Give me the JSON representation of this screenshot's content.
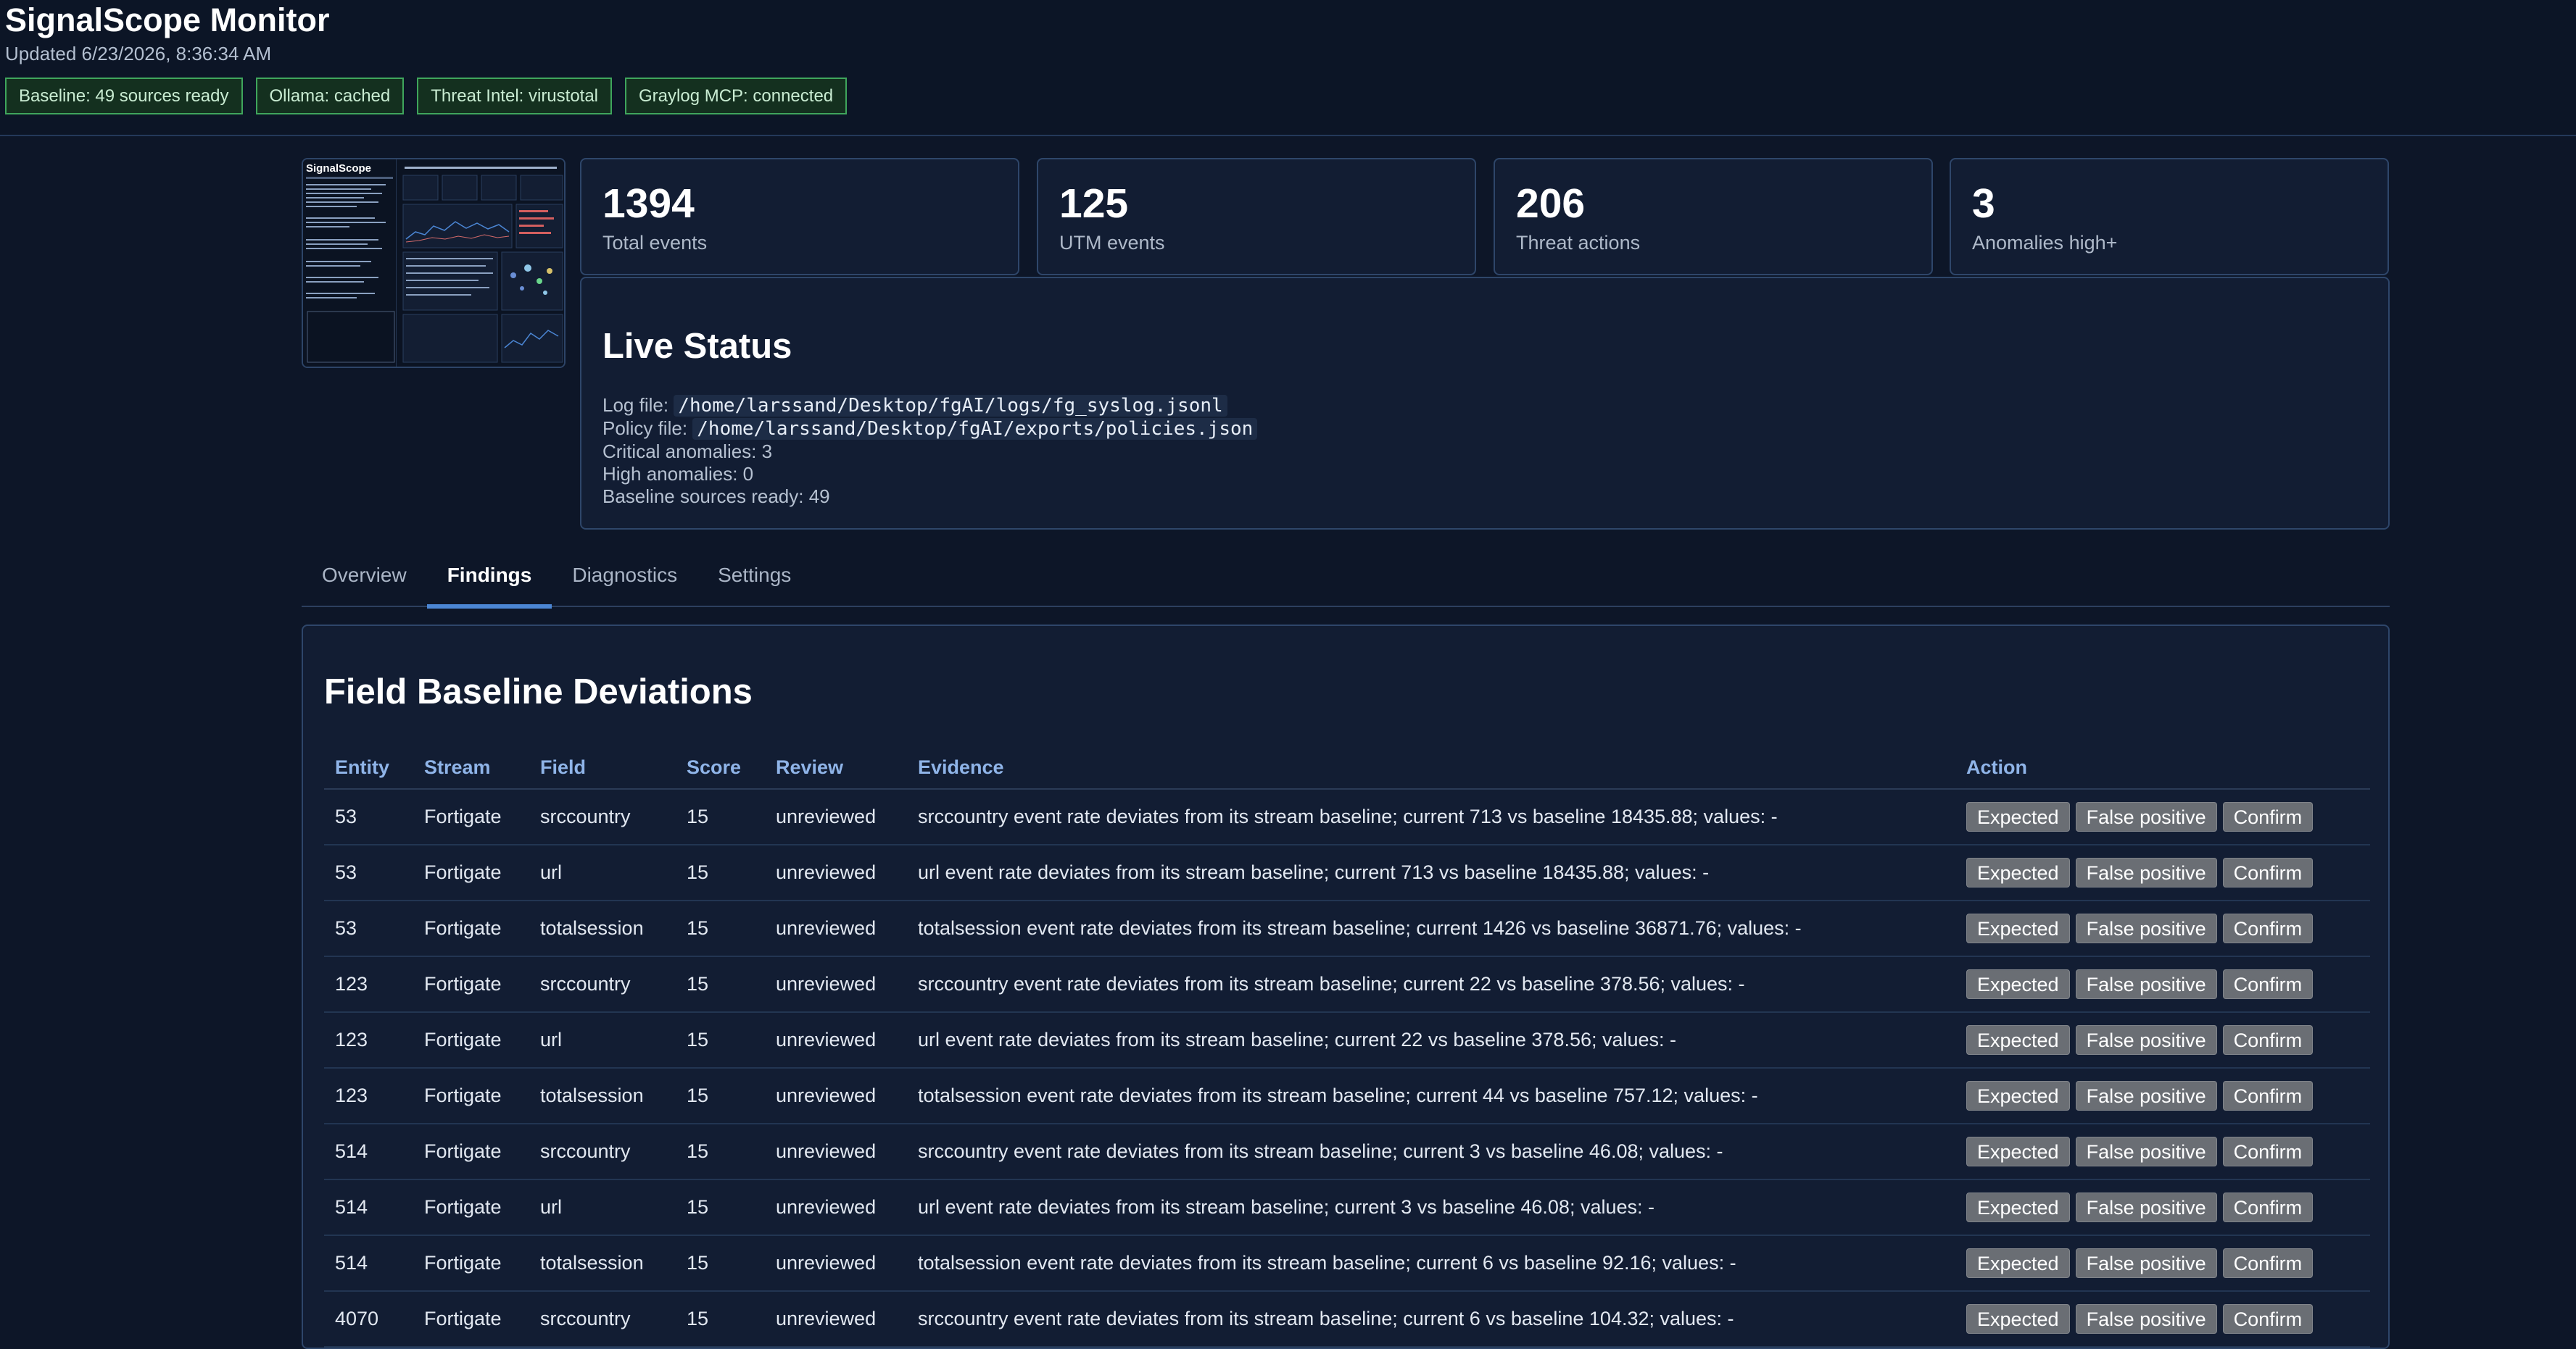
{
  "header": {
    "title": "SignalScope Monitor",
    "updated": "Updated 6/23/2026, 8:36:34 AM",
    "badges": [
      "Baseline: 49 sources ready",
      "Ollama: cached",
      "Threat Intel: virustotal",
      "Graylog MCP: connected"
    ]
  },
  "thumbnail": {
    "title": "SignalScope"
  },
  "stats": [
    {
      "value": "1394",
      "label": "Total events"
    },
    {
      "value": "125",
      "label": "UTM events"
    },
    {
      "value": "206",
      "label": "Threat actions"
    },
    {
      "value": "3",
      "label": "Anomalies high+"
    }
  ],
  "live_status": {
    "title": "Live Status",
    "log_label": "Log file:",
    "log_path": "/home/larssand/Desktop/fgAI/logs/fg_syslog.jsonl",
    "policy_label": "Policy file:",
    "policy_path": "/home/larssand/Desktop/fgAI/exports/policies.json",
    "critical": "Critical anomalies: 3",
    "high": "High anomalies: 0",
    "baseline": "Baseline sources ready: 49"
  },
  "tabs": [
    "Overview",
    "Findings",
    "Diagnostics",
    "Settings"
  ],
  "findings": {
    "title": "Field Baseline Deviations",
    "columns": [
      "Entity",
      "Stream",
      "Field",
      "Score",
      "Review",
      "Evidence",
      "Action"
    ],
    "actions": [
      "Expected",
      "False positive",
      "Confirm"
    ],
    "rows": [
      [
        "53",
        "Fortigate",
        "srccountry",
        "15",
        "unreviewed",
        "srccountry event rate deviates from its stream baseline; current 713 vs baseline 18435.88; values: -"
      ],
      [
        "53",
        "Fortigate",
        "url",
        "15",
        "unreviewed",
        "url event rate deviates from its stream baseline; current 713 vs baseline 18435.88; values: -"
      ],
      [
        "53",
        "Fortigate",
        "totalsession",
        "15",
        "unreviewed",
        "totalsession event rate deviates from its stream baseline; current 1426 vs baseline 36871.76; values: -"
      ],
      [
        "123",
        "Fortigate",
        "srccountry",
        "15",
        "unreviewed",
        "srccountry event rate deviates from its stream baseline; current 22 vs baseline 378.56; values: -"
      ],
      [
        "123",
        "Fortigate",
        "url",
        "15",
        "unreviewed",
        "url event rate deviates from its stream baseline; current 22 vs baseline 378.56; values: -"
      ],
      [
        "123",
        "Fortigate",
        "totalsession",
        "15",
        "unreviewed",
        "totalsession event rate deviates from its stream baseline; current 44 vs baseline 757.12; values: -"
      ],
      [
        "514",
        "Fortigate",
        "srccountry",
        "15",
        "unreviewed",
        "srccountry event rate deviates from its stream baseline; current 3 vs baseline 46.08; values: -"
      ],
      [
        "514",
        "Fortigate",
        "url",
        "15",
        "unreviewed",
        "url event rate deviates from its stream baseline; current 3 vs baseline 46.08; values: -"
      ],
      [
        "514",
        "Fortigate",
        "totalsession",
        "15",
        "unreviewed",
        "totalsession event rate deviates from its stream baseline; current 6 vs baseline 92.16; values: -"
      ],
      [
        "4070",
        "Fortigate",
        "srccountry",
        "15",
        "unreviewed",
        "srccountry event rate deviates from its stream baseline; current 6 vs baseline 104.32; values: -"
      ]
    ]
  }
}
